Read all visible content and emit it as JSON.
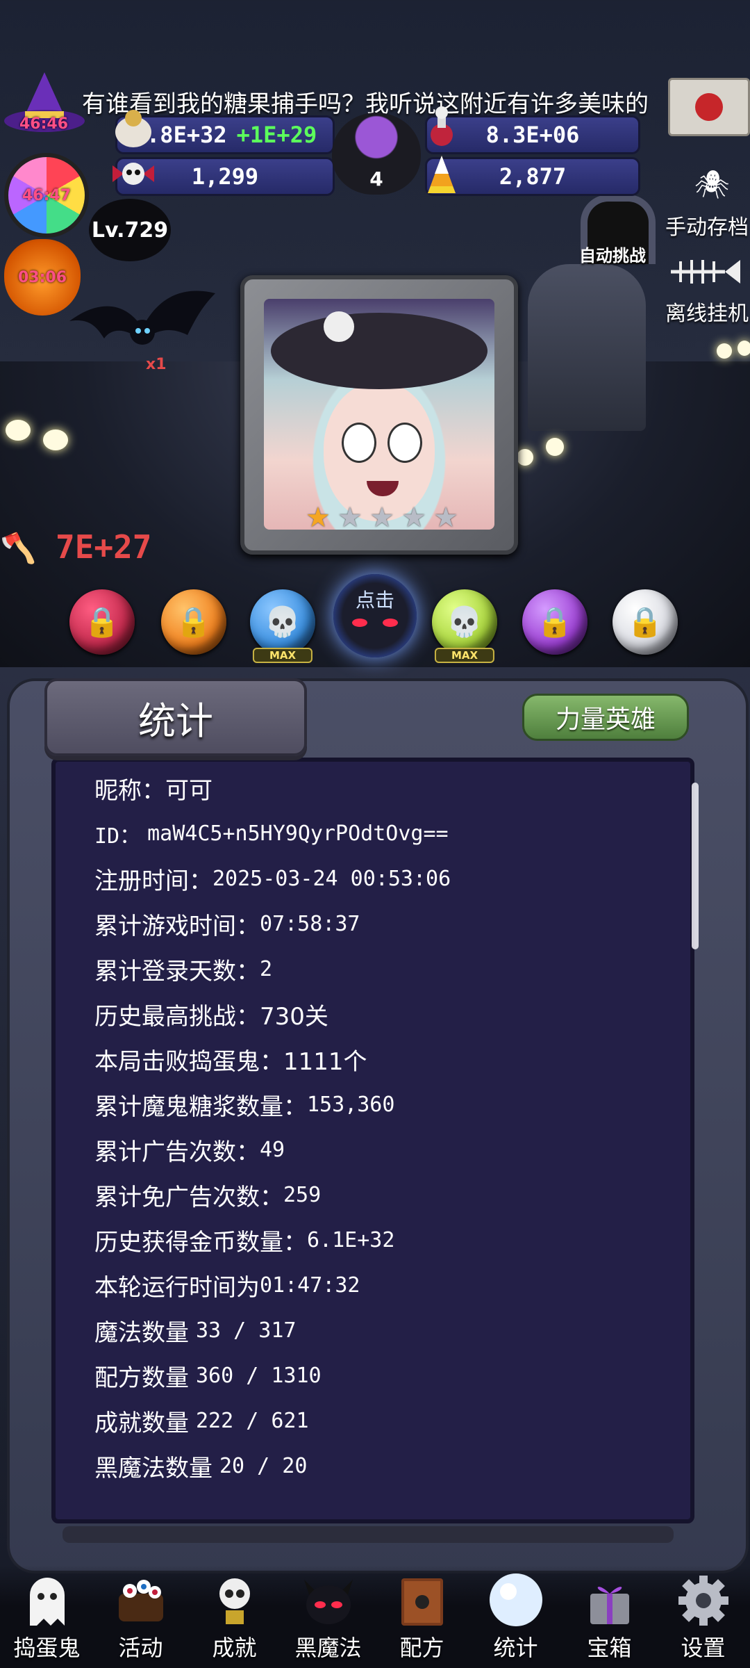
{
  "marquee": "有谁看到我的糖果捕手吗？我听说这附近有许多美味的",
  "timers": {
    "hat": "46:46",
    "candy": "46:47",
    "pumpkin": "03:06"
  },
  "hud": {
    "gold": "2.8E+32",
    "gold_rate": "+1E+29",
    "syrup": "8.3E+06",
    "skull_count": "1,299",
    "candy_corn": "2,877",
    "cauldron_count": "4",
    "level": "Lv.729"
  },
  "side": {
    "auto_challenge": "自动挑战",
    "manual_save": "手动存档",
    "offline_idle": "离线挂机"
  },
  "scene": {
    "damage": "7E+27",
    "bat_multiplier": "x1",
    "stars_filled": 1,
    "stars_total": 5
  },
  "orbs": {
    "click_label": "点击",
    "max_label": "MAX",
    "items": [
      {
        "name": "red-lock-orb",
        "color": "#c2294c",
        "locked": true
      },
      {
        "name": "orange-lock-orb",
        "color": "#f0801e",
        "locked": true
      },
      {
        "name": "blue-skull-orb",
        "color": "#3a8fe0",
        "locked": false,
        "max": true
      },
      {
        "name": "black-demon-orb",
        "color": "#121320",
        "locked": false,
        "click": true
      },
      {
        "name": "green-skull-orb",
        "color": "#a8d43c",
        "locked": false,
        "max": true
      },
      {
        "name": "purple-lock-orb",
        "color": "#9b3fd2",
        "locked": true
      },
      {
        "name": "white-lock-orb",
        "color": "#d9dbe2",
        "locked": true
      }
    ]
  },
  "panel": {
    "title": "统计",
    "hero_button": "力量英雄",
    "lines": [
      {
        "label": "昵称：",
        "value": "可可"
      },
      {
        "label": "ID：",
        "value": "maW4C5+n5HY9QyrPOdtOvg=="
      },
      {
        "label": "注册时间：",
        "value": "2025-03-24 00:53:06"
      },
      {
        "label": "累计游戏时间：",
        "value": "07:58:37"
      },
      {
        "label": "累计登录天数：",
        "value": "2"
      },
      {
        "label": "历史最高挑战：",
        "value": "730关"
      },
      {
        "label": "本局击败捣蛋鬼：",
        "value": "1111个"
      },
      {
        "label": "累计魔鬼糖浆数量：",
        "value": "153,360"
      },
      {
        "label": "累计广告次数：",
        "value": "49"
      },
      {
        "label": "累计免广告次数：",
        "value": "259"
      },
      {
        "label": "历史获得金币数量：",
        "value": "6.1E+32"
      },
      {
        "label": "本轮运行时间为",
        "value": "01:47:32"
      },
      {
        "label": "魔法数量 ",
        "value": "33 / 317"
      },
      {
        "label": "配方数量 ",
        "value": "360 / 1310"
      },
      {
        "label": "成就数量 ",
        "value": "222 / 621"
      },
      {
        "label": "黑魔法数量 ",
        "value": "20 / 20"
      }
    ]
  },
  "nav": [
    {
      "label": "捣蛋鬼",
      "icon": "ghost-icon"
    },
    {
      "label": "活动",
      "icon": "eyeball-cake-icon"
    },
    {
      "label": "成就",
      "icon": "skull-trophy-icon"
    },
    {
      "label": "黑魔法",
      "icon": "demon-head-icon"
    },
    {
      "label": "配方",
      "icon": "spellbook-icon"
    },
    {
      "label": "统计",
      "icon": "crystal-ball-icon"
    },
    {
      "label": "宝箱",
      "icon": "gift-chest-icon"
    },
    {
      "label": "设置",
      "icon": "gear-icon"
    }
  ]
}
